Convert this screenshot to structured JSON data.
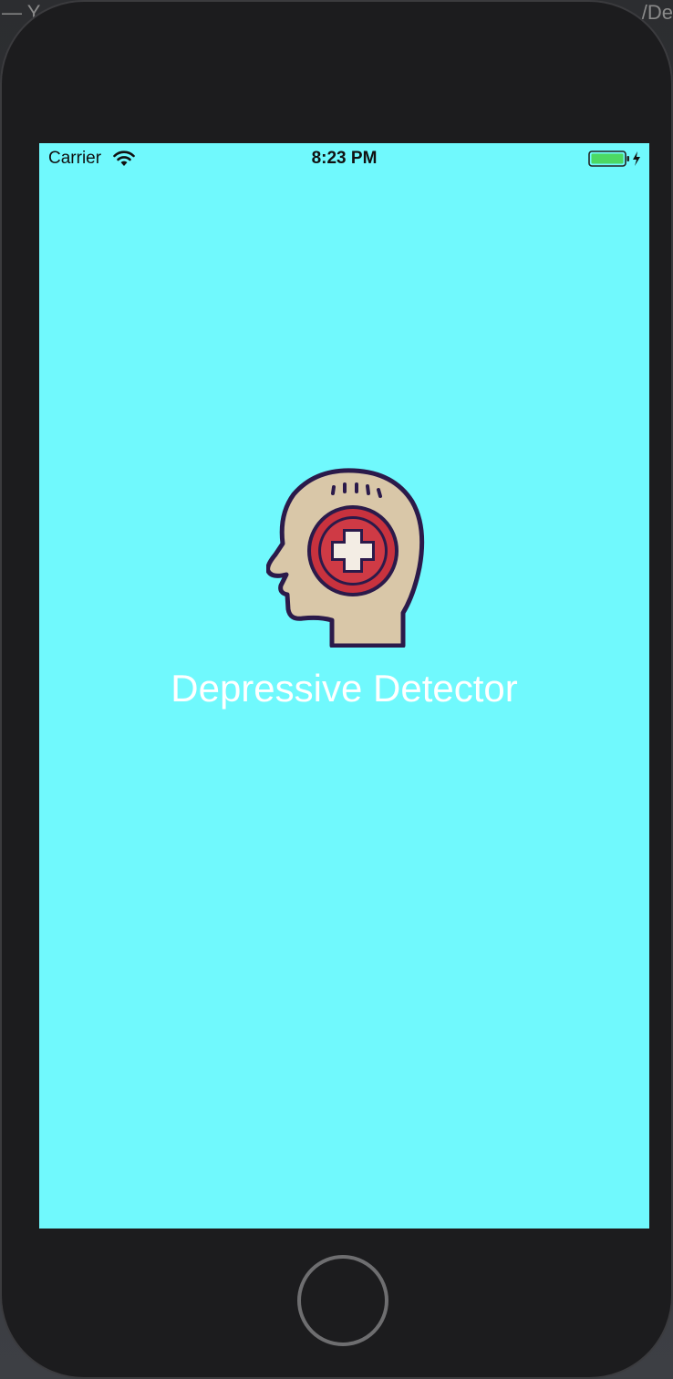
{
  "window": {
    "left_fragment": "— Y",
    "right_fragment": "/De"
  },
  "status_bar": {
    "carrier": "Carrier",
    "time": "8:23 PM",
    "icons": [
      "wifi-icon",
      "battery-charging-icon"
    ]
  },
  "app": {
    "title": "Depressive Detector",
    "logo_icon": "head-medical-cross-icon",
    "background_color": "#70f9fd",
    "title_color": "#ffffff"
  },
  "device": {
    "home_button_icon": "home-button"
  }
}
